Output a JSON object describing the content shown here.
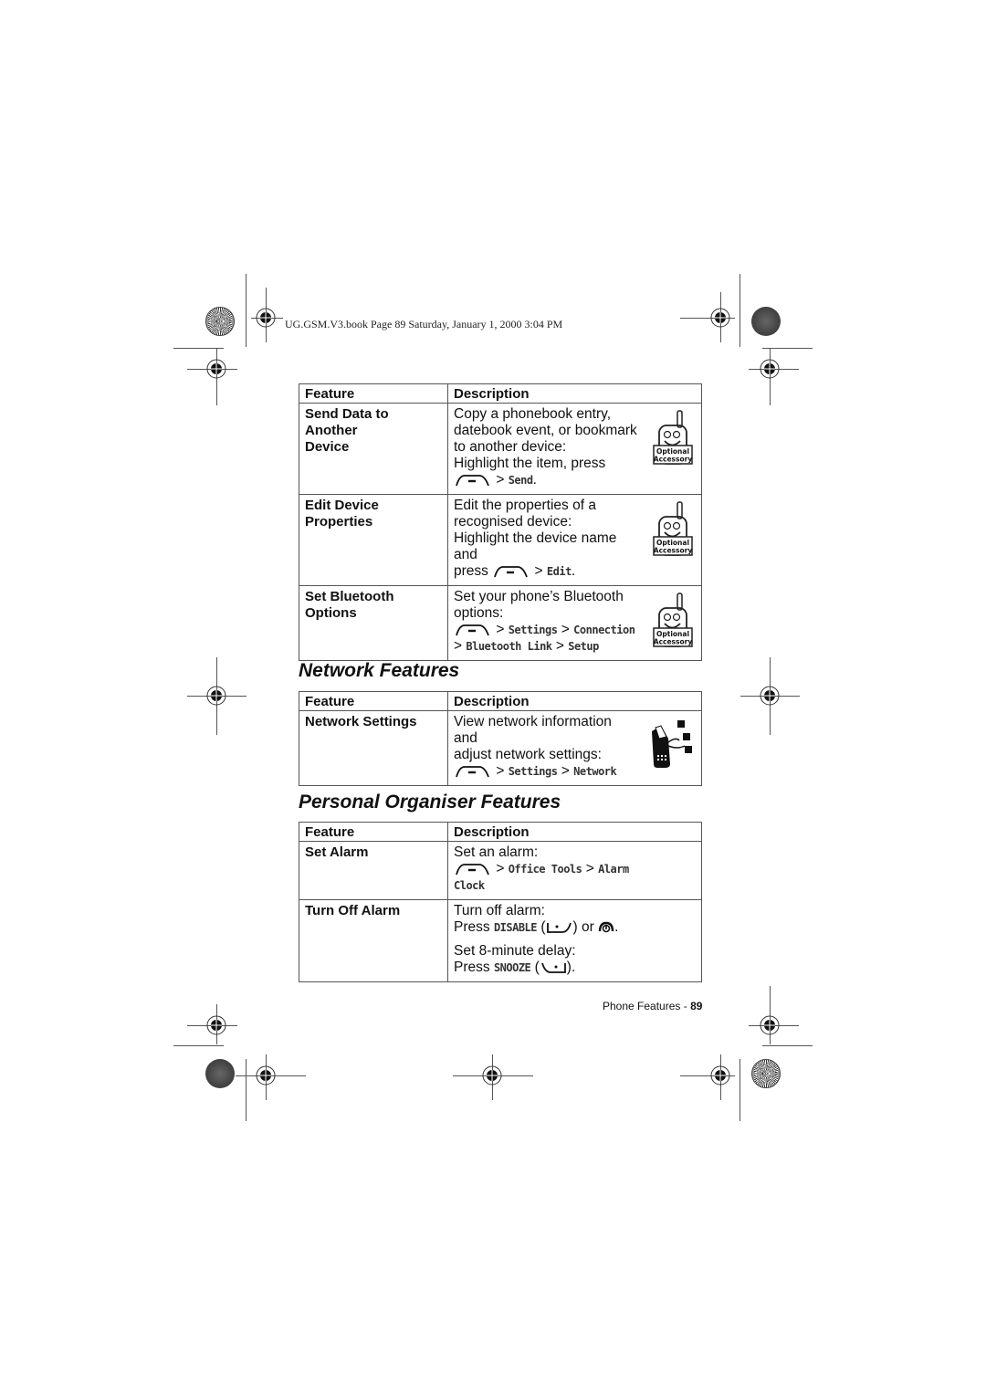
{
  "header": {
    "print_slug": "UG.GSM.V3.book  Page 89  Saturday, January 1, 2000  3:04 PM"
  },
  "tables": {
    "column_headers": {
      "feature": "Feature",
      "description": "Description"
    },
    "connection": {
      "rows": [
        {
          "feature_line1": "Send Data to Another",
          "feature_line2": "Device",
          "desc_lines": [
            "Copy a phonebook entry,",
            "datebook event, or bookmark",
            "to another device:",
            "Highlight the item, press"
          ],
          "menu_path": [
            ">",
            "Send",
            "."
          ],
          "icon": "optional-accessory-icon",
          "icon_text": [
            "Optional",
            "Accessory"
          ]
        },
        {
          "feature_line1": "Edit Device",
          "feature_line2": "Properties",
          "desc_lines": [
            "Edit the properties of a",
            "recognised device:",
            "Highlight the device name and"
          ],
          "press_prefix": "press",
          "menu_path": [
            ">",
            "Edit",
            "."
          ],
          "icon": "optional-accessory-icon",
          "icon_text": [
            "Optional",
            "Accessory"
          ]
        },
        {
          "feature_line1": "Set Bluetooth",
          "feature_line2": "Options",
          "desc_lines": [
            "Set your phone’s Bluetooth",
            "options:"
          ],
          "menu_path_line1": [
            ">",
            "Settings",
            ">",
            "Connection"
          ],
          "menu_path_line2": [
            ">",
            "Bluetooth Link",
            ">",
            "Setup"
          ],
          "icon": "optional-accessory-icon",
          "icon_text": [
            "Optional",
            "Accessory"
          ]
        }
      ]
    },
    "network": {
      "title": "Network Features",
      "rows": [
        {
          "feature": "Network Settings",
          "desc_lines": [
            "View network information and",
            "adjust network settings:"
          ],
          "menu_path": [
            ">",
            "Settings",
            ">",
            "Network"
          ],
          "icon": "network-phone-icon"
        }
      ]
    },
    "organiser": {
      "title": "Personal Organiser Features",
      "rows": [
        {
          "feature": "Set Alarm",
          "desc_lines": [
            "Set an alarm:"
          ],
          "menu_path": [
            ">",
            "Office Tools",
            ">",
            "Alarm Clock"
          ]
        },
        {
          "feature": "Turn Off Alarm",
          "desc_line1": "Turn off alarm:",
          "press": "Press",
          "disable_label": "DISABLE",
          "or_text": "or",
          "desc_line3": "Set 8-minute delay:",
          "snooze_label": "SNOOZE",
          "open_paren": "(",
          "close_paren": ")",
          "close_paren_period": ").",
          "period": "."
        }
      ]
    }
  },
  "footer": {
    "section": "Phone Features - ",
    "page_number": "89"
  }
}
